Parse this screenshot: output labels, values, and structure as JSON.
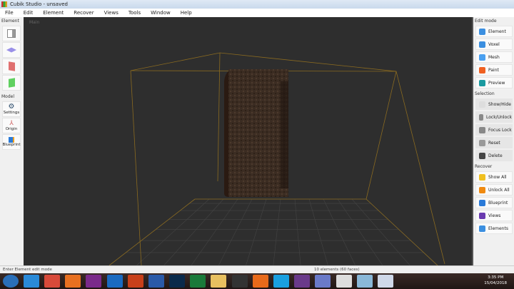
{
  "window": {
    "title": "Cubik Studio - unsaved"
  },
  "menu": [
    "File",
    "Edit",
    "Element",
    "Recover",
    "Views",
    "Tools",
    "Window",
    "Help"
  ],
  "left": {
    "element_label": "Element",
    "model_label": "Model",
    "model_items": [
      "Settings",
      "Origin",
      "Blueprint"
    ]
  },
  "viewport": {
    "label": "Main"
  },
  "right": {
    "edit_mode": {
      "label": "Edit mode",
      "items": [
        {
          "label": "Element",
          "color": "#3b8fe0"
        },
        {
          "label": "Voxel",
          "color": "#3b8fe0"
        },
        {
          "label": "Mesh",
          "color": "#4aa0f0"
        },
        {
          "label": "Paint",
          "color": "#f06020"
        },
        {
          "label": "Preview",
          "color": "#1a9aa0"
        }
      ]
    },
    "selection": {
      "label": "Selection",
      "items": [
        {
          "label": "Show/Hide",
          "color": "#ddd"
        },
        {
          "label": "Lock/Unlock",
          "color": "#888"
        },
        {
          "label": "Focus Lock",
          "color": "#888"
        },
        {
          "label": "Reset",
          "color": "#999"
        },
        {
          "label": "Delete",
          "color": "#444"
        }
      ]
    },
    "recover": {
      "label": "Recover",
      "items": [
        {
          "label": "Show All",
          "color": "#f0c020"
        },
        {
          "label": "Unlock All",
          "color": "#f08a10"
        },
        {
          "label": "Blueprint",
          "color": "#2a7ad8"
        },
        {
          "label": "Views",
          "color": "#6a3ab0"
        },
        {
          "label": "Elements",
          "color": "#3b8fe0"
        }
      ]
    }
  },
  "status": {
    "hint": "Enter Element edit mode",
    "count": "10 elements (60 faces)"
  },
  "taskbar": {
    "apps": [
      {
        "name": "windows-start",
        "color": "#2a6fb8"
      },
      {
        "name": "internet-explorer",
        "color": "#2a8ad8"
      },
      {
        "name": "chrome",
        "color": "#d84a3a"
      },
      {
        "name": "media-player",
        "color": "#e87020"
      },
      {
        "name": "onenote",
        "color": "#7a2a8a"
      },
      {
        "name": "outlook",
        "color": "#1a6ac0"
      },
      {
        "name": "powerpoint",
        "color": "#c8401a"
      },
      {
        "name": "word",
        "color": "#2a5aa8"
      },
      {
        "name": "photoshop",
        "color": "#0a2a4a"
      },
      {
        "name": "excel",
        "color": "#1a7a3a"
      },
      {
        "name": "file-explorer",
        "color": "#e8c060"
      },
      {
        "name": "nox",
        "color": "#333"
      },
      {
        "name": "firefox",
        "color": "#e86a1a"
      },
      {
        "name": "skype",
        "color": "#1aa0e0"
      },
      {
        "name": "winrar",
        "color": "#6a3a8a"
      },
      {
        "name": "discord",
        "color": "#6a7ac8"
      },
      {
        "name": "cubik-studio",
        "color": "#ddd"
      },
      {
        "name": "notes",
        "color": "#8ab8d8"
      },
      {
        "name": "settings-app",
        "color": "#cfd8e8"
      }
    ],
    "time": "3:35 PM",
    "date": "15/04/2018"
  }
}
